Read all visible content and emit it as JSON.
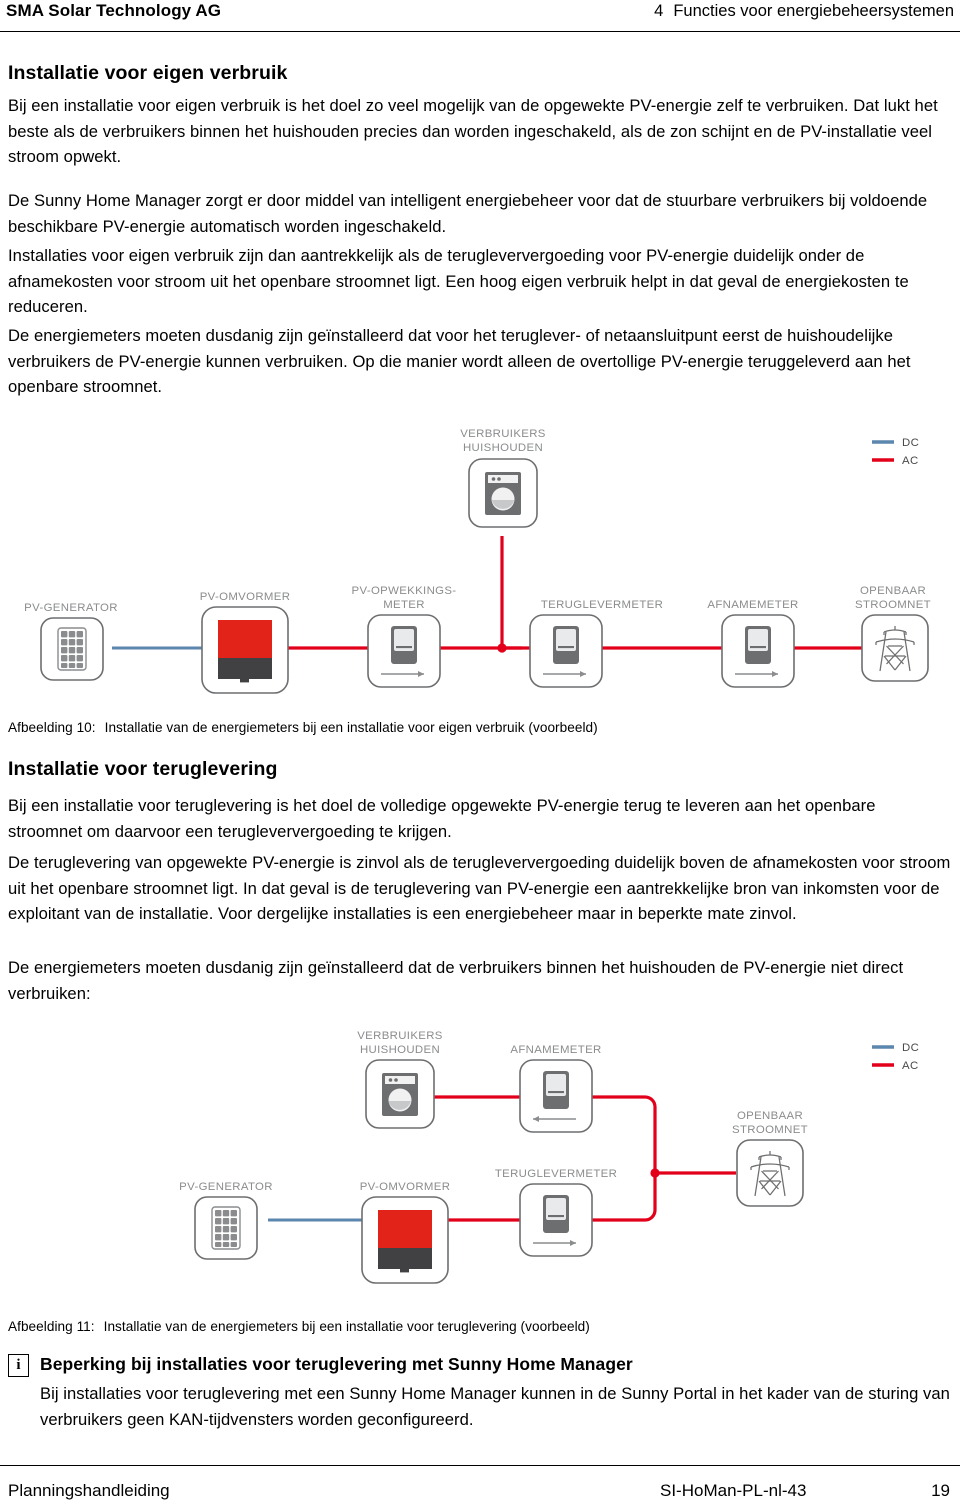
{
  "header": {
    "company": "SMA Solar Technology AG",
    "section_number": "4",
    "section_title": "Functies voor energiebeheersystemen"
  },
  "sections": [
    {
      "heading": "Installatie voor eigen verbruik",
      "paragraphs": [
        "Bij een installatie voor eigen verbruik is het doel zo veel mogelijk van de opgewekte PV-energie zelf te verbruiken. Dat lukt het beste als de verbruikers binnen het huishouden precies dan worden ingeschakeld, als de zon schijnt en de PV-installatie veel stroom opwekt.",
        "De Sunny Home Manager zorgt er door middel van intelligent energiebeheer voor dat de stuurbare verbruikers bij voldoende beschikbare PV-energie automatisch worden ingeschakeld.",
        "Installaties voor eigen verbruik zijn dan aantrekkelijk als de terugleververgoeding voor PV-energie duidelijk onder de afnamekosten voor stroom uit het openbare stroomnet ligt. Een hoog eigen verbruik helpt in dat geval de energiekosten te reduceren.",
        "De energiemeters moeten dusdanig zijn geïnstalleerd dat voor het teruglever- of netaansluitpunt eerst de huishoudelijke verbruikers de PV-energie kunnen verbruiken. Op die manier wordt alleen de overtollige PV-energie teruggeleverd aan het openbare stroomnet."
      ]
    },
    {
      "heading": "Installatie voor teruglevering",
      "paragraphs": [
        "Bij een installatie voor teruglevering is het doel de volledige opgewekte PV-energie terug te leveren aan het openbare stroomnet om daarvoor een terugleververgoeding te krijgen.",
        "De teruglevering van opgewekte PV-energie is zinvol als de terugleververgoeding duidelijk boven de afnamekosten voor stroom uit het openbare stroomnet ligt. In dat geval is de teruglevering van PV-energie een aantrekkelijke bron van inkomsten voor de exploitant van de installatie. Voor dergelijke installaties is een energiebeheer maar in beperkte mate zinvol.",
        "De energiemeters moeten dusdanig zijn geïnstalleerd dat de verbruikers binnen het huishouden de PV-energie niet direct verbruiken:"
      ]
    }
  ],
  "figures": [
    {
      "number": "Afbeelding 10:",
      "caption": "Installatie van de energiemeters bij een installatie voor eigen verbruik (voorbeeld)",
      "legend": [
        {
          "label": "DC",
          "color": "#5b86ae"
        },
        {
          "label": "AC",
          "color": "#e2001a"
        }
      ],
      "nodes": [
        {
          "id": "pv-generator",
          "label": "PV-GENERATOR",
          "icon": "solar-panel-icon"
        },
        {
          "id": "pv-inverter",
          "label": "PV-OMVORMER",
          "icon": "inverter-icon"
        },
        {
          "id": "pv-production-meter",
          "label_line1": "PV-OPWEKKINGS-",
          "label_line2": "METER",
          "icon": "energy-meter-icon"
        },
        {
          "id": "household-loads",
          "label_line1": "VERBRUIKERS",
          "label_line2": "HUISHOUDEN",
          "icon": "washing-machine-icon"
        },
        {
          "id": "feed-in-meter",
          "label": "TERUGLEVERMETER",
          "icon": "energy-meter-icon"
        },
        {
          "id": "consumption-meter",
          "label": "AFNAMEMETER",
          "icon": "energy-meter-icon"
        },
        {
          "id": "public-grid",
          "label_line1": "OPENBAAR",
          "label_line2": "STROOMNET",
          "icon": "pylon-icon"
        }
      ]
    },
    {
      "number": "Afbeelding 11:",
      "caption": "Installatie van de energiemeters bij een installatie voor teruglevering (voorbeeld)",
      "legend": [
        {
          "label": "DC",
          "color": "#5b86ae"
        },
        {
          "label": "AC",
          "color": "#e2001a"
        }
      ],
      "nodes": [
        {
          "id": "household-loads",
          "label_line1": "VERBRUIKERS",
          "label_line2": "HUISHOUDEN",
          "icon": "washing-machine-icon"
        },
        {
          "id": "consumption-meter",
          "label": "AFNAMEMETER",
          "icon": "energy-meter-icon"
        },
        {
          "id": "public-grid",
          "label_line1": "OPENBAAR",
          "label_line2": "STROOMNET",
          "icon": "pylon-icon"
        },
        {
          "id": "pv-generator",
          "label": "PV-GENERATOR",
          "icon": "solar-panel-icon"
        },
        {
          "id": "pv-inverter",
          "label": "PV-OMVORMER",
          "icon": "inverter-icon"
        },
        {
          "id": "feed-in-meter",
          "label": "TERUGLEVERMETER",
          "icon": "energy-meter-icon"
        }
      ]
    }
  ],
  "note": {
    "icon": "info-icon",
    "icon_glyph": "i",
    "title": "Beperking bij installaties voor teruglevering met Sunny Home Manager",
    "body": "Bij installaties voor teruglevering met een Sunny Home Manager kunnen in de Sunny Portal in het kader van de sturing van verbruikers geen KAN-tijdvensters worden geconfigureerd."
  },
  "footer": {
    "left": "Planningshandleiding",
    "middle": "SI-HoMan-PL-nl-43",
    "right": "19"
  },
  "colors": {
    "ac": "#e2001a",
    "dc": "#5b86ae",
    "node_stroke": "#6d6e70",
    "label": "#8a8c8e",
    "icon_gray": "#6d6e70",
    "inverter_red": "#e2231a",
    "inverter_dark": "#414042"
  }
}
